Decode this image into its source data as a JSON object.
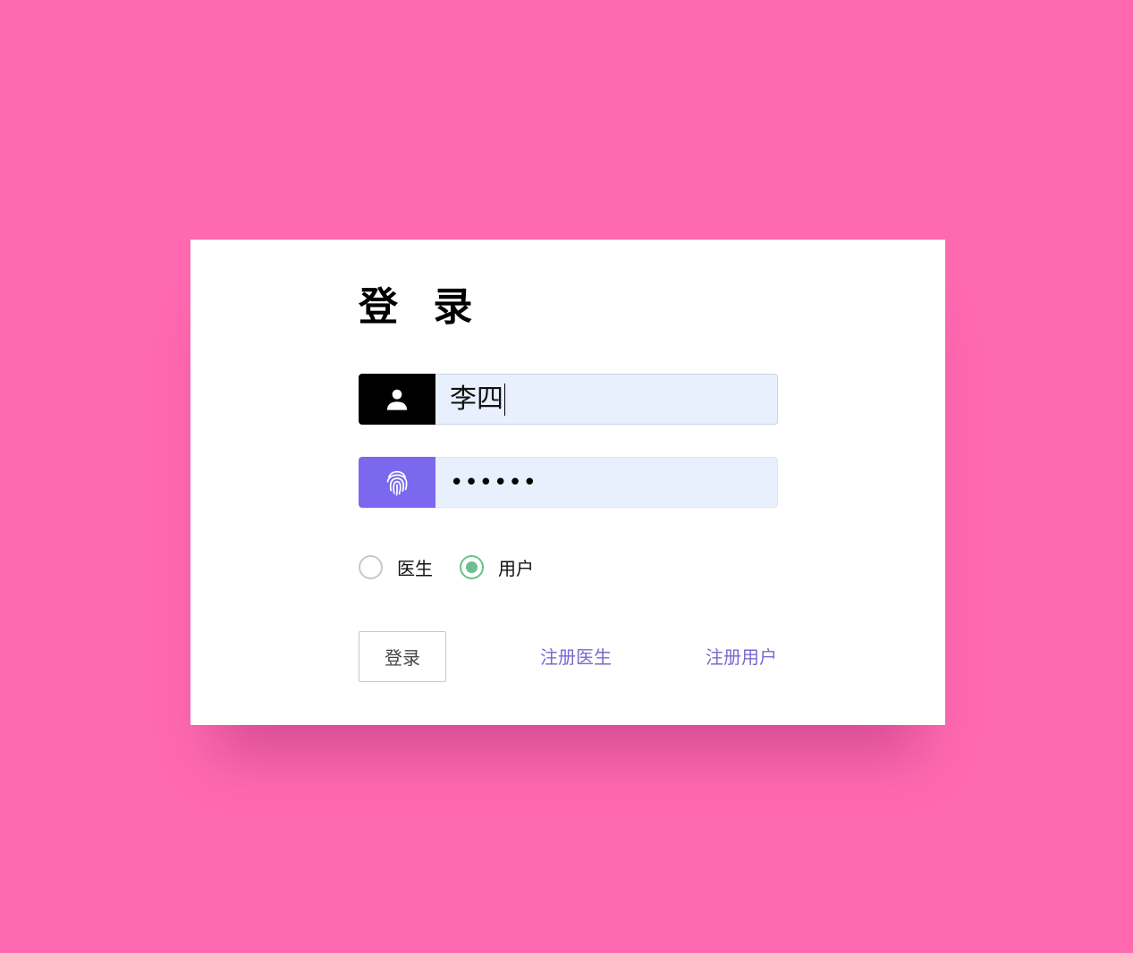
{
  "login": {
    "title": "登 录",
    "username": {
      "value": "李四",
      "icon": "user-icon"
    },
    "password": {
      "value": "••••••",
      "icon": "fingerprint-icon"
    },
    "roles": [
      {
        "label": "医生",
        "checked": false
      },
      {
        "label": "用户",
        "checked": true
      }
    ],
    "submit_label": "登录",
    "register_doctor_label": "注册医生",
    "register_user_label": "注册用户"
  },
  "colors": {
    "background": "#ff69b0",
    "card": "#ffffff",
    "password_icon_bg": "#7b68ee",
    "radio_checked": "#6cc08b",
    "link": "#7b68cc",
    "input_bg": "#e8f0fe"
  }
}
